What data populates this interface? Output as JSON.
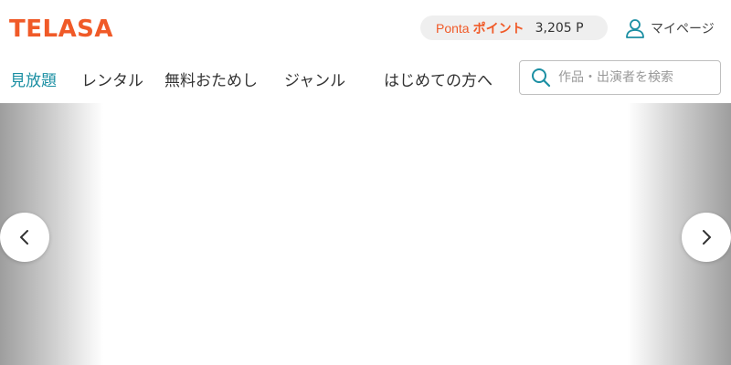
{
  "header": {
    "logo_text": "TELASA",
    "ponta": {
      "label": "Ponta",
      "points_label": "ポイント",
      "value": "3,205 P"
    },
    "mypage_label": "マイページ"
  },
  "nav": {
    "items": [
      {
        "label": "見放題",
        "active": true
      },
      {
        "label": "レンタル",
        "active": false
      },
      {
        "label": "無料おためし",
        "active": false
      },
      {
        "label": "ジャンル",
        "active": false
      },
      {
        "label": "はじめての方へ",
        "active": false
      }
    ]
  },
  "search": {
    "placeholder": "作品・出演者を検索",
    "value": ""
  },
  "icons": {
    "user": "user-icon",
    "search": "search-icon",
    "prev": "chevron-left-icon",
    "next": "chevron-right-icon"
  },
  "colors": {
    "brand": "#f05a28",
    "accent": "#1b8fa3",
    "pill_bg": "#efefef"
  }
}
